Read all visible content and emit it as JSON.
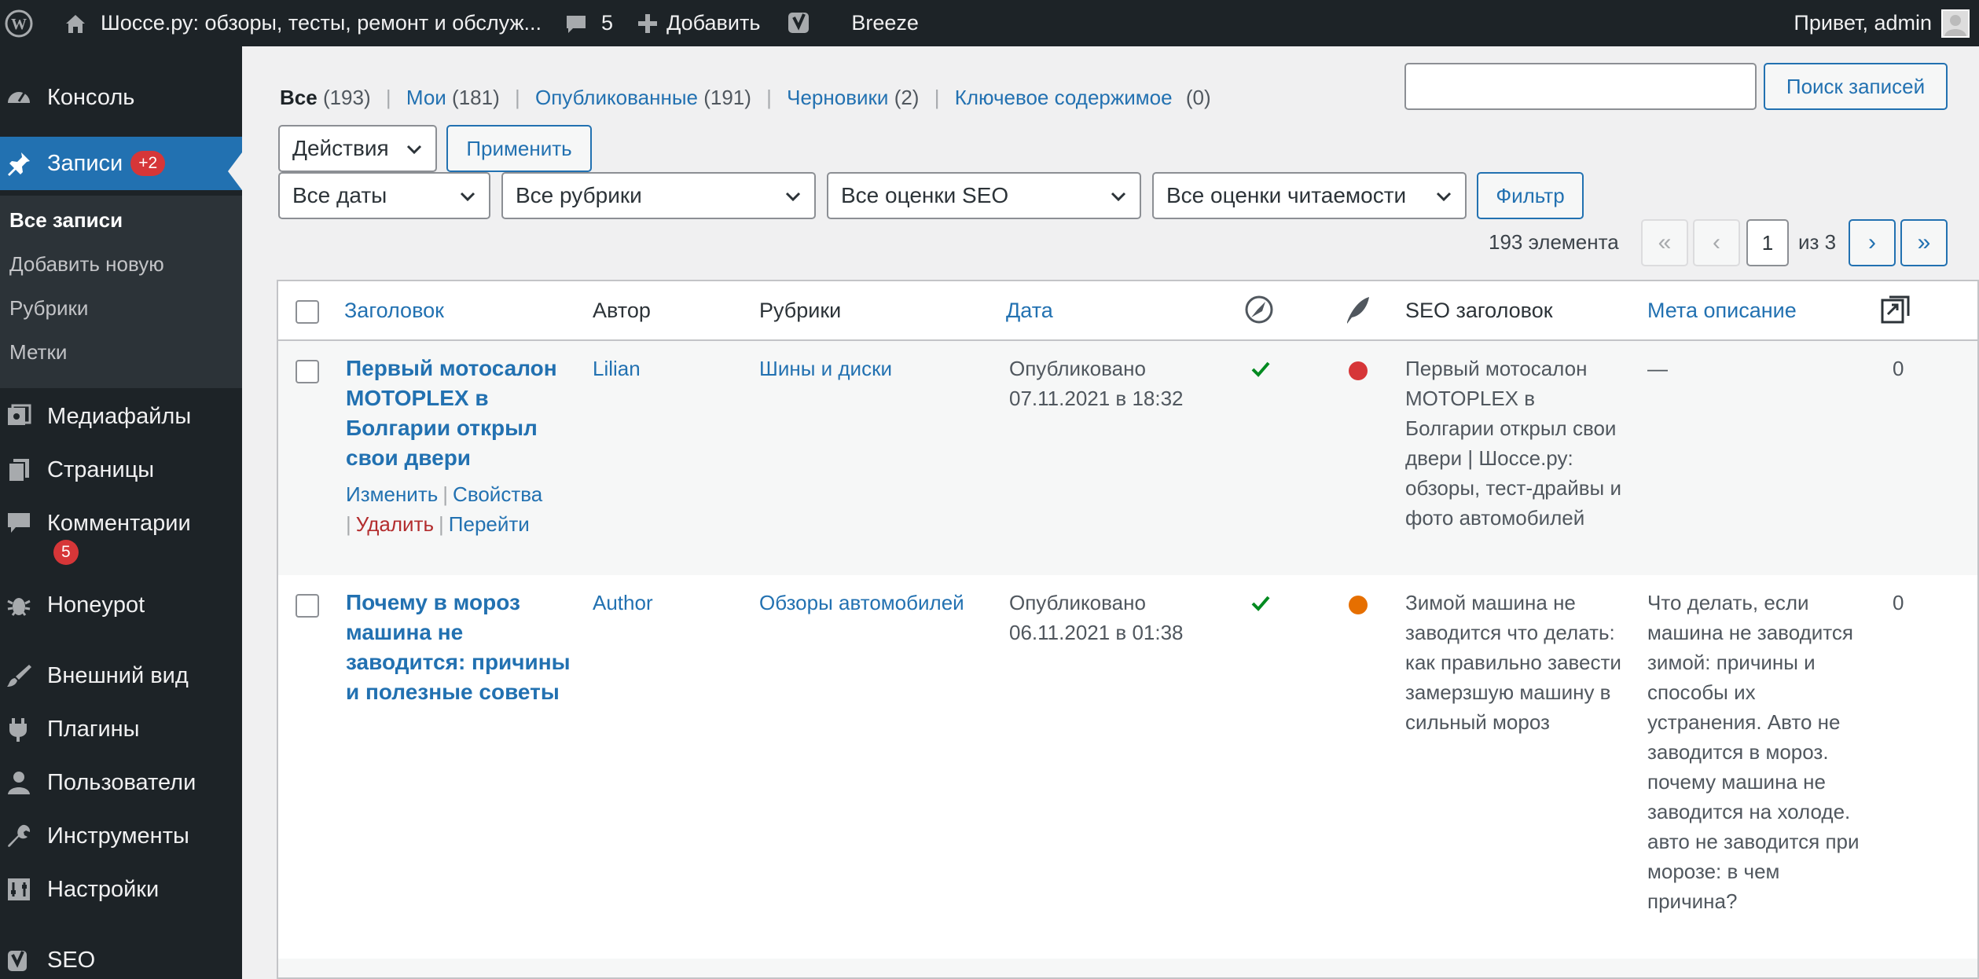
{
  "adminbar": {
    "site_title": "Шоссе.ру: обзоры, тесты, ремонт и обслуж...",
    "comments_count": "5",
    "add_label": "Добавить",
    "breeze_label": "Breeze",
    "greeting": "Привет, admin"
  },
  "sidebar": {
    "items": [
      {
        "label": "Консоль",
        "icon": "dashboard-icon"
      },
      {
        "label": "Записи",
        "icon": "pin-icon",
        "badge": "+2"
      },
      {
        "label": "Медиафайлы",
        "icon": "media-icon"
      },
      {
        "label": "Страницы",
        "icon": "pages-icon"
      },
      {
        "label": "Комментарии",
        "icon": "comments-icon",
        "badge": "5"
      },
      {
        "label": "Honeypot",
        "icon": "bug-icon"
      },
      {
        "label": "Внешний вид",
        "icon": "brush-icon"
      },
      {
        "label": "Плагины",
        "icon": "plugin-icon"
      },
      {
        "label": "Пользователи",
        "icon": "users-icon"
      },
      {
        "label": "Инструменты",
        "icon": "wrench-icon"
      },
      {
        "label": "Настройки",
        "icon": "settings-icon"
      },
      {
        "label": "SEO",
        "icon": "yoast-icon"
      }
    ],
    "submenu": [
      "Все записи",
      "Добавить новую",
      "Рубрики",
      "Метки"
    ]
  },
  "filters": {
    "views": [
      {
        "label": "Все",
        "count": "(193)"
      },
      {
        "label": "Мои",
        "count": "(181)"
      },
      {
        "label": "Опубликованные",
        "count": "(191)"
      },
      {
        "label": "Черновики",
        "count": "(2)"
      },
      {
        "label": "Ключевое содержимое",
        "count": "(0)"
      }
    ],
    "bulk_actions": "Действия",
    "apply": "Применить",
    "dates": "Все даты",
    "categories": "Все рубрики",
    "seo_scores": "Все оценки SEO",
    "readability": "Все оценки читаемости",
    "filter": "Фильтр",
    "search_button": "Поиск записей",
    "search_value": ""
  },
  "pagination": {
    "items_count": "193 элемента",
    "first": "«",
    "prev": "‹",
    "current": "1",
    "of_total": "из 3",
    "next": "›",
    "last": "»"
  },
  "table": {
    "columns": {
      "title": "Заголовок",
      "author": "Автор",
      "categories": "Рубрики",
      "date": "Дата",
      "seo_title": "SEO заголовок",
      "meta": "Мета описание"
    },
    "row_actions": {
      "edit": "Изменить",
      "props": "Свойства",
      "delete": "Удалить",
      "view": "Перейти"
    },
    "rows": [
      {
        "title": "Первый мотосалон MOTOPLEX в Болгарии открыл свои двери",
        "author": "Lilian",
        "category": "Шины и диски",
        "status": "Опубликовано",
        "date": "07.11.2021 в 18:32",
        "seo_color": "#d63638",
        "seo_title": "Первый мотосалон MOTOPLEX в Болгарии открыл свои двери | Шоссе.ру: обзоры, тест-драйвы и фото автомобилей",
        "meta": "—",
        "links": "0"
      },
      {
        "title": "Почему в мороз машина не заводится: причины и полезные советы",
        "author": "Author",
        "category": "Обзоры автомобилей",
        "status": "Опубликовано",
        "date": "06.11.2021 в 01:38",
        "seo_color": "#e66f00",
        "seo_title": "Зимой машина не заводится что делать: как правильно завести замерзшую машину в сильный мороз",
        "meta": "Что делать, если машина не заводится зимой: причины и способы их устранения. Авто не заводится в мороз. почему машина не заводится на холоде. авто не заводится при морозе: в чем причина?",
        "links": "0"
      }
    ]
  },
  "colors": {
    "accent": "#2271b1",
    "adminbar": "#1d2327",
    "danger": "#d63638",
    "ok": "#008a20"
  }
}
